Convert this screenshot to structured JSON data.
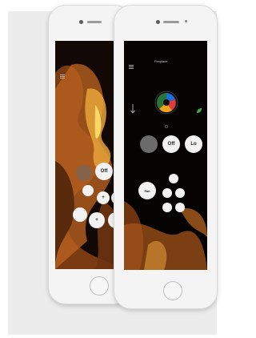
{
  "back_phone": {
    "off_label": "Off",
    "plus_label": "+",
    "minus_label": "−",
    "menu_icon": "hamburger-menu-icon"
  },
  "front_phone": {
    "app_title": "Fireplace",
    "off_label": "Off",
    "lo_label": "Lo",
    "fan_label": "Fan",
    "flame_color_swatches": [
      "#1e6fd9",
      "#e23b3b",
      "#f3a21b",
      "#3fbf5b"
    ],
    "menu_icon": "hamburger-menu-icon",
    "down_arrow_icon": "arrow-down-icon",
    "leaf_icon": "leaf-icon",
    "leaf_color": "#48a843"
  }
}
